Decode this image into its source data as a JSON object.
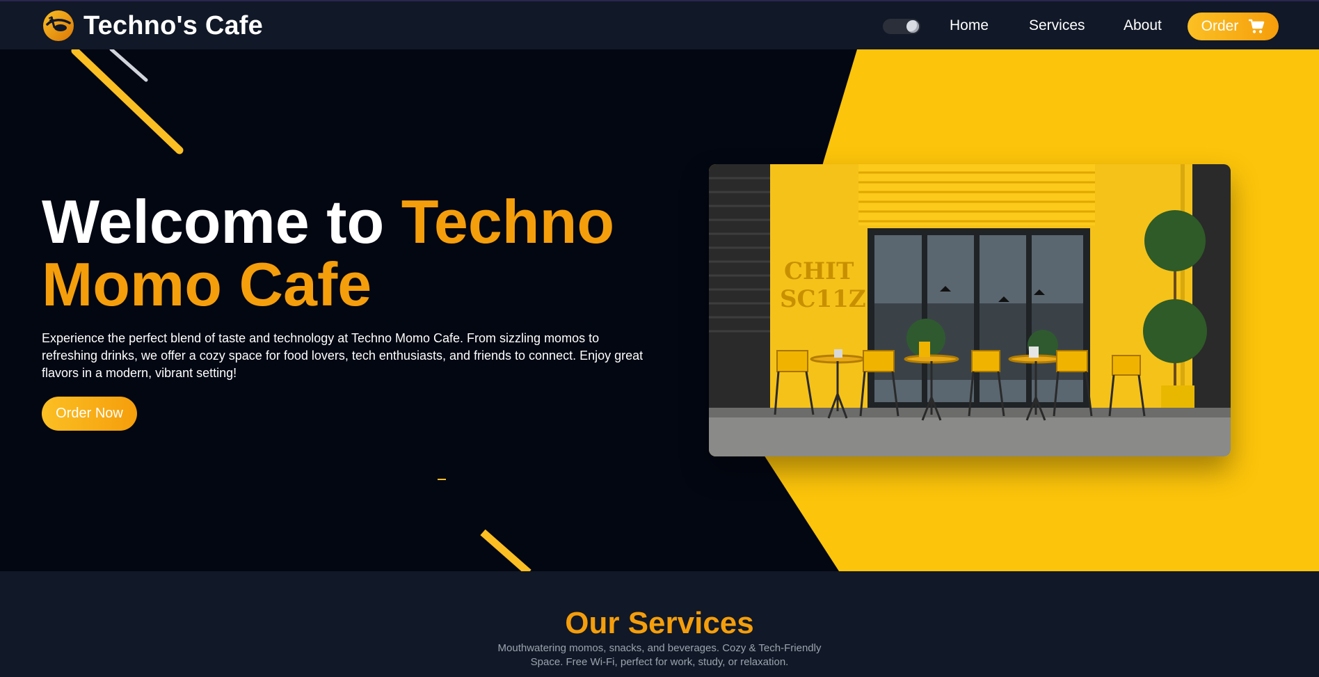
{
  "navbar": {
    "brand": "Techno's Cafe",
    "logo_icon": "cafe-logo-icon",
    "links": {
      "home": "Home",
      "services": "Services",
      "about": "About"
    },
    "order_label": "Order",
    "cart_icon": "cart-icon",
    "theme_toggle_icon": "moon-icon"
  },
  "hero": {
    "title_lead": "Welcome to ",
    "title_accent": "Techno Momo Cafe",
    "description": "Experience the perfect blend of taste and technology at Techno Momo Cafe. From sizzling momos to refreshing drinks, we offer a cozy space for food lovers, tech enthusiasts, and friends to connect. Enjoy great flavors in a modern, vibrant setting!",
    "cta_label": "Order Now",
    "image_sign": [
      "CHIT",
      "SC11Z"
    ]
  },
  "services": {
    "title": "Our Services",
    "subtitle": "Mouthwatering momos, snacks, and beverages. Cozy & Tech-Friendly Space. Free Wi-Fi, perfect for work, study, or relaxation."
  },
  "colors": {
    "accent": "#f59e0b",
    "accent_light": "#fbbf24",
    "hero_yellow": "#fcc40a",
    "navbar_bg": "#111827",
    "hero_bg": "#030712"
  }
}
